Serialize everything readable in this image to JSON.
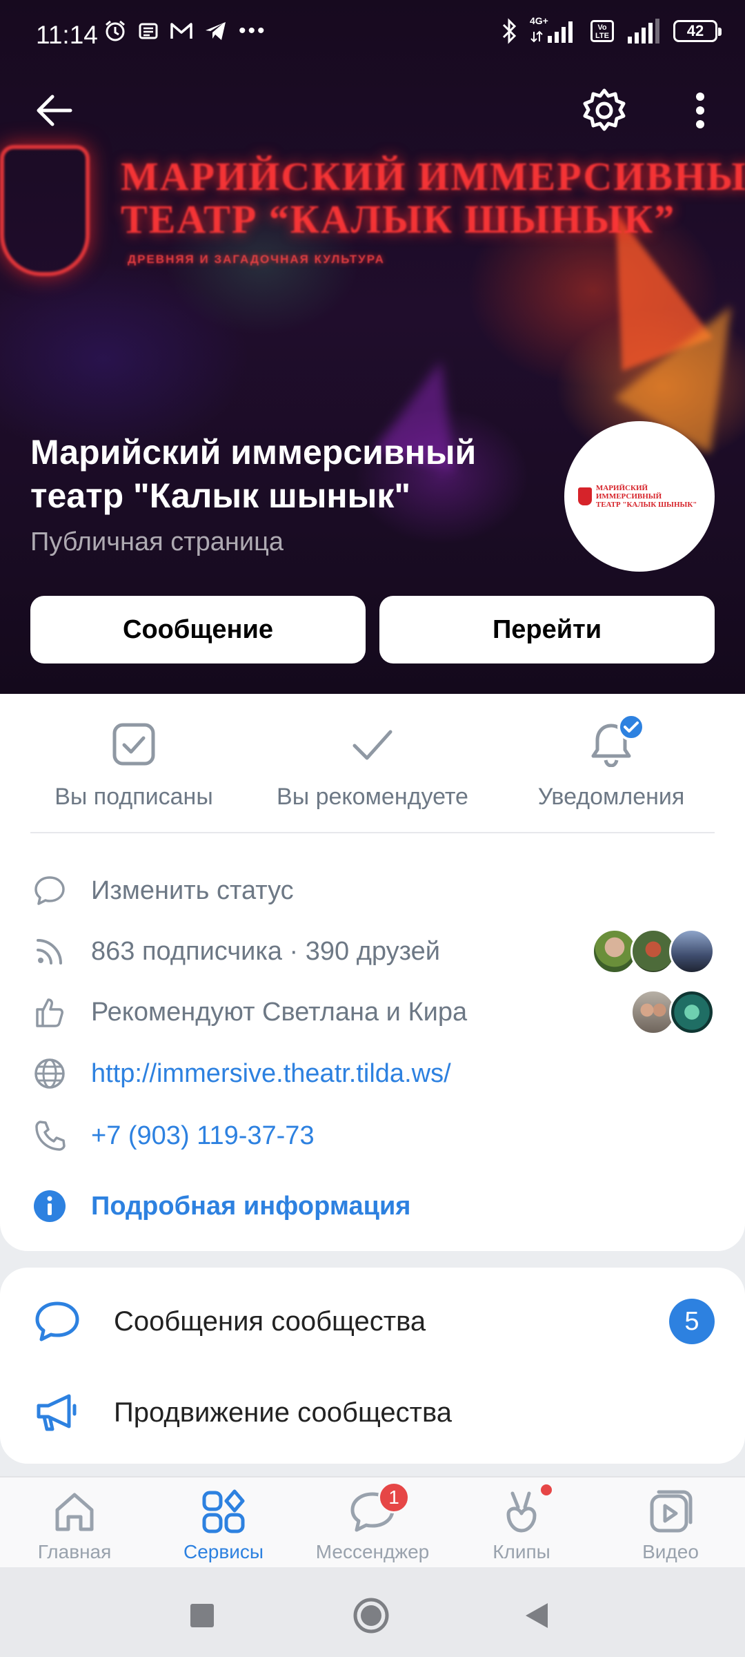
{
  "status_bar": {
    "time": "11:14",
    "battery": "42",
    "network_label": "4G+"
  },
  "cover": {
    "neon_line1": "МАРИЙСКИЙ ИММЕРСИВНЫЙ",
    "neon_line2": "ТЕАТР “КАЛЫК ШЫНЫК”",
    "neon_sub": "ДРЕВНЯЯ И ЗАГАДОЧНАЯ КУЛЬТУРА"
  },
  "group": {
    "name": "Марийский иммерсивный театр \"Калык шынык\"",
    "type": "Публичная страница",
    "avatar_line1": "МАРИЙСКИЙ ИММЕРСИВНЫЙ",
    "avatar_line2": "ТЕАТР \"КАЛЫК ШЫНЫК\""
  },
  "buttons": {
    "message": "Сообщение",
    "go": "Перейти"
  },
  "actions": [
    {
      "label": "Вы подписаны",
      "icon": "subscribed-check-icon"
    },
    {
      "label": "Вы рекомендуете",
      "icon": "recommend-check-icon"
    },
    {
      "label": "Уведомления",
      "icon": "bell-icon"
    }
  ],
  "info": {
    "status": "Изменить статус",
    "followers": "863 подписчика · 390 друзей",
    "recommend": "Рекомендуют Светлана и Кира",
    "website": "http://immersive.theatr.tilda.ws/",
    "phone": "+7 (903) 119-37-73",
    "details": "Подробная информация"
  },
  "community": {
    "messages_label": "Сообщения сообщества",
    "messages_count": "5",
    "promotion_label": "Продвижение сообщества"
  },
  "tabbar": [
    {
      "label": "Главная",
      "icon": "home-icon"
    },
    {
      "label": "Сервисы",
      "icon": "services-icon",
      "active": true
    },
    {
      "label": "Мессенджер",
      "icon": "messenger-icon",
      "badge": "1"
    },
    {
      "label": "Клипы",
      "icon": "clips-icon"
    },
    {
      "label": "Видео",
      "icon": "video-icon"
    }
  ],
  "colors": {
    "accent": "#2d81e0",
    "badge_red": "#e64646",
    "secondary_text": "#6d7885"
  }
}
